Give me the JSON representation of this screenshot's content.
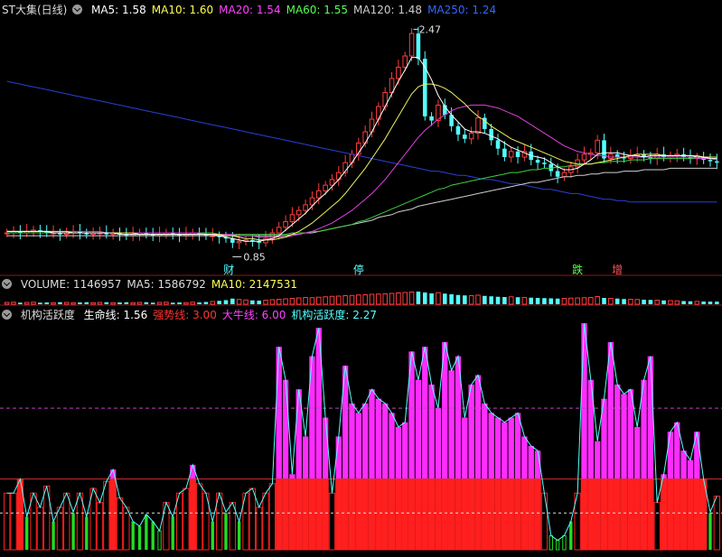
{
  "main_header": {
    "title": "ST大集(日线)",
    "items": [
      {
        "label": "MA5: 1.58",
        "color": "#ffffff"
      },
      {
        "label": "MA10: 1.60",
        "color": "#ffff55"
      },
      {
        "label": "MA20: 1.54",
        "color": "#ff44ff"
      },
      {
        "label": "MA60: 1.55",
        "color": "#55ff55"
      },
      {
        "label": "MA120: 1.48",
        "color": "#cccccc"
      },
      {
        "label": "MA250: 1.24",
        "color": "#3366ff"
      }
    ]
  },
  "volume_header": {
    "items": [
      {
        "label": "VOLUME: 1146957",
        "color": "#dddddd"
      },
      {
        "label": "MA5: 1586792",
        "color": "#dddddd"
      },
      {
        "label": "MA10: 2147531",
        "color": "#ffff55"
      }
    ]
  },
  "indicator_header": {
    "title": "机构活跃度",
    "items": [
      {
        "label": "生命线: 1.56",
        "color": "#ffffff"
      },
      {
        "label": "强势线: 3.00",
        "color": "#ff3333"
      },
      {
        "label": "大牛线: 6.00",
        "color": "#ff44ff"
      },
      {
        "label": "机构活跃度: 2.27",
        "color": "#55ffff"
      }
    ]
  },
  "annotations": {
    "high_label": "2.47",
    "low_label": "0.85",
    "events": [
      {
        "text": "财",
        "color": "#55ffff"
      },
      {
        "text": "停",
        "color": "#55ffff"
      },
      {
        "text": "跌",
        "color": "#55ff55"
      },
      {
        "text": "增",
        "color": "#ff5555"
      }
    ]
  },
  "chart_data": [
    {
      "type": "candlestick",
      "name": "price",
      "ylim": [
        0.75,
        2.55
      ],
      "close": [
        1.02,
        1.03,
        1.02,
        1.03,
        1.04,
        1.03,
        1.02,
        1.02,
        1.01,
        1.02,
        1.03,
        1.02,
        1.01,
        1.02,
        1.02,
        1.01,
        1.02,
        1.01,
        1.0,
        1.01,
        1.02,
        1.01,
        1.0,
        1.01,
        1.02,
        1.01,
        1.0,
        1.01,
        1.02,
        1.01,
        1.0,
        1.0,
        0.99,
        0.98,
        0.95,
        0.96,
        0.97,
        0.96,
        0.95,
        0.98,
        1.02,
        1.06,
        1.1,
        1.15,
        1.18,
        1.22,
        1.27,
        1.32,
        1.36,
        1.4,
        1.45,
        1.52,
        1.58,
        1.66,
        1.74,
        1.83,
        1.92,
        2.02,
        2.12,
        2.2,
        2.28,
        2.44,
        2.26,
        1.85,
        1.82,
        1.93,
        1.86,
        1.78,
        1.72,
        1.69,
        1.73,
        1.84,
        1.76,
        1.68,
        1.62,
        1.56,
        1.6,
        1.56,
        1.6,
        1.54,
        1.52,
        1.51,
        1.46,
        1.42,
        1.45,
        1.49,
        1.54,
        1.58,
        1.59,
        1.68,
        1.55,
        1.58,
        1.56,
        1.55,
        1.57,
        1.58,
        1.56,
        1.55,
        1.58,
        1.56,
        1.57,
        1.58,
        1.56,
        1.55,
        1.56,
        1.54,
        1.53,
        1.52
      ],
      "ma5": [
        1.03,
        1.03,
        1.03,
        1.03,
        1.03,
        1.03,
        1.03,
        1.02,
        1.02,
        1.02,
        1.02,
        1.02,
        1.02,
        1.02,
        1.02,
        1.02,
        1.02,
        1.01,
        1.01,
        1.01,
        1.01,
        1.01,
        1.01,
        1.01,
        1.01,
        1.01,
        1.01,
        1.01,
        1.01,
        1.01,
        1.01,
        1.01,
        1.0,
        0.99,
        0.98,
        0.97,
        0.96,
        0.96,
        0.96,
        0.97,
        0.98,
        1.0,
        1.04,
        1.08,
        1.12,
        1.16,
        1.21,
        1.26,
        1.3,
        1.35,
        1.4,
        1.46,
        1.52,
        1.59,
        1.66,
        1.74,
        1.83,
        1.92,
        2.01,
        2.1,
        2.18,
        2.27,
        2.27,
        2.2,
        2.11,
        2.0,
        1.92,
        1.86,
        1.81,
        1.76,
        1.74,
        1.74,
        1.73,
        1.71,
        1.69,
        1.66,
        1.63,
        1.61,
        1.59,
        1.57,
        1.56,
        1.55,
        1.52,
        1.49,
        1.47,
        1.47,
        1.48,
        1.51,
        1.54,
        1.58,
        1.59,
        1.59,
        1.59,
        1.58,
        1.57,
        1.57,
        1.56,
        1.57,
        1.57,
        1.57,
        1.57,
        1.57,
        1.57,
        1.57,
        1.56,
        1.56,
        1.55,
        1.55
      ],
      "ma10": [
        1.03,
        1.03,
        1.03,
        1.03,
        1.03,
        1.03,
        1.03,
        1.03,
        1.03,
        1.03,
        1.02,
        1.02,
        1.02,
        1.02,
        1.02,
        1.02,
        1.02,
        1.02,
        1.02,
        1.02,
        1.01,
        1.01,
        1.01,
        1.01,
        1.01,
        1.01,
        1.01,
        1.01,
        1.01,
        1.01,
        1.01,
        1.01,
        1.01,
        1.0,
        1.0,
        0.99,
        0.98,
        0.98,
        0.97,
        0.97,
        0.97,
        0.98,
        0.99,
        1.01,
        1.03,
        1.06,
        1.09,
        1.13,
        1.17,
        1.21,
        1.25,
        1.3,
        1.36,
        1.42,
        1.48,
        1.55,
        1.62,
        1.69,
        1.77,
        1.85,
        1.93,
        2.01,
        2.06,
        2.08,
        2.08,
        2.07,
        2.05,
        2.02,
        1.98,
        1.94,
        1.89,
        1.85,
        1.82,
        1.78,
        1.75,
        1.72,
        1.69,
        1.67,
        1.65,
        1.63,
        1.61,
        1.59,
        1.57,
        1.55,
        1.53,
        1.52,
        1.51,
        1.51,
        1.51,
        1.52,
        1.53,
        1.54,
        1.55,
        1.56,
        1.57,
        1.58,
        1.58,
        1.58,
        1.58,
        1.57,
        1.57,
        1.57,
        1.57,
        1.57,
        1.57,
        1.56,
        1.56,
        1.56
      ],
      "ma20": [
        1.03,
        1.03,
        1.03,
        1.03,
        1.03,
        1.03,
        1.03,
        1.03,
        1.03,
        1.03,
        1.03,
        1.03,
        1.03,
        1.03,
        1.03,
        1.02,
        1.02,
        1.02,
        1.02,
        1.02,
        1.02,
        1.02,
        1.02,
        1.02,
        1.02,
        1.02,
        1.02,
        1.02,
        1.02,
        1.02,
        1.01,
        1.01,
        1.01,
        1.01,
        1.01,
        1.0,
        1.0,
        1.0,
        0.99,
        0.99,
        0.99,
        0.99,
        0.99,
        1.0,
        1.01,
        1.02,
        1.03,
        1.05,
        1.07,
        1.09,
        1.12,
        1.15,
        1.18,
        1.22,
        1.26,
        1.3,
        1.35,
        1.4,
        1.46,
        1.52,
        1.58,
        1.64,
        1.7,
        1.75,
        1.79,
        1.83,
        1.86,
        1.89,
        1.91,
        1.92,
        1.93,
        1.93,
        1.93,
        1.92,
        1.91,
        1.89,
        1.87,
        1.85,
        1.82,
        1.79,
        1.76,
        1.73,
        1.7,
        1.67,
        1.64,
        1.62,
        1.6,
        1.59,
        1.58,
        1.57,
        1.57,
        1.56,
        1.56,
        1.56,
        1.56,
        1.56,
        1.56,
        1.56,
        1.56,
        1.56,
        1.56,
        1.56,
        1.56,
        1.56,
        1.55,
        1.55,
        1.55,
        1.54
      ],
      "ma60": [
        1.02,
        1.02,
        1.02,
        1.02,
        1.02,
        1.02,
        1.02,
        1.02,
        1.02,
        1.02,
        1.02,
        1.02,
        1.02,
        1.02,
        1.02,
        1.02,
        1.02,
        1.02,
        1.02,
        1.02,
        1.02,
        1.02,
        1.02,
        1.02,
        1.02,
        1.02,
        1.02,
        1.02,
        1.02,
        1.02,
        1.02,
        1.02,
        1.01,
        1.01,
        1.01,
        1.01,
        1.01,
        1.01,
        1.01,
        1.01,
        1.01,
        1.01,
        1.01,
        1.02,
        1.02,
        1.02,
        1.03,
        1.03,
        1.04,
        1.05,
        1.06,
        1.07,
        1.08,
        1.1,
        1.11,
        1.13,
        1.15,
        1.17,
        1.19,
        1.21,
        1.23,
        1.25,
        1.27,
        1.29,
        1.31,
        1.33,
        1.34,
        1.36,
        1.37,
        1.38,
        1.39,
        1.4,
        1.41,
        1.42,
        1.43,
        1.44,
        1.45,
        1.45,
        1.46,
        1.47,
        1.47,
        1.48,
        1.48,
        1.49,
        1.49,
        1.5,
        1.5,
        1.51,
        1.51,
        1.52,
        1.52,
        1.53,
        1.53,
        1.53,
        1.54,
        1.54,
        1.54,
        1.55,
        1.55,
        1.55,
        1.55,
        1.55,
        1.55,
        1.55,
        1.55,
        1.55,
        1.55,
        1.55
      ],
      "ma120": [
        1.0,
        1.0,
        1.0,
        1.0,
        1.0,
        1.0,
        1.0,
        1.0,
        1.0,
        1.0,
        1.0,
        1.0,
        1.0,
        1.0,
        1.0,
        1.0,
        1.0,
        1.0,
        1.0,
        1.0,
        1.0,
        1.0,
        1.0,
        1.0,
        1.0,
        1.0,
        1.0,
        1.0,
        1.0,
        1.0,
        1.0,
        1.0,
        1.0,
        1.0,
        1.0,
        1.0,
        1.0,
        1.0,
        1.0,
        1.0,
        1.0,
        1.0,
        1.0,
        1.01,
        1.01,
        1.02,
        1.02,
        1.03,
        1.04,
        1.05,
        1.06,
        1.07,
        1.08,
        1.09,
        1.1,
        1.11,
        1.13,
        1.14,
        1.15,
        1.17,
        1.18,
        1.19,
        1.21,
        1.22,
        1.23,
        1.24,
        1.25,
        1.26,
        1.27,
        1.28,
        1.29,
        1.3,
        1.31,
        1.32,
        1.33,
        1.34,
        1.35,
        1.36,
        1.37,
        1.38,
        1.38,
        1.39,
        1.4,
        1.41,
        1.42,
        1.42,
        1.43,
        1.43,
        1.44,
        1.44,
        1.45,
        1.45,
        1.45,
        1.46,
        1.46,
        1.46,
        1.47,
        1.47,
        1.47,
        1.47,
        1.48,
        1.48,
        1.48,
        1.48,
        1.48,
        1.48,
        1.48,
        1.48
      ],
      "ma250": [
        2.1,
        2.09,
        2.08,
        2.07,
        2.06,
        2.05,
        2.04,
        2.03,
        2.02,
        2.01,
        2.0,
        1.99,
        1.98,
        1.97,
        1.96,
        1.95,
        1.94,
        1.93,
        1.92,
        1.91,
        1.9,
        1.89,
        1.88,
        1.87,
        1.86,
        1.85,
        1.84,
        1.83,
        1.82,
        1.81,
        1.8,
        1.79,
        1.78,
        1.77,
        1.76,
        1.75,
        1.74,
        1.73,
        1.72,
        1.71,
        1.7,
        1.69,
        1.68,
        1.67,
        1.66,
        1.65,
        1.64,
        1.63,
        1.62,
        1.61,
        1.6,
        1.59,
        1.58,
        1.57,
        1.56,
        1.55,
        1.54,
        1.53,
        1.52,
        1.51,
        1.5,
        1.49,
        1.48,
        1.47,
        1.46,
        1.46,
        1.45,
        1.44,
        1.43,
        1.43,
        1.42,
        1.41,
        1.4,
        1.4,
        1.39,
        1.38,
        1.37,
        1.37,
        1.36,
        1.35,
        1.34,
        1.33,
        1.33,
        1.32,
        1.31,
        1.3,
        1.3,
        1.29,
        1.28,
        1.27,
        1.26,
        1.26,
        1.25,
        1.25,
        1.24,
        1.24,
        1.24,
        1.24,
        1.24,
        1.24,
        1.24,
        1.24,
        1.24,
        1.24,
        1.24,
        1.24,
        1.24,
        1.24
      ]
    },
    {
      "type": "bar",
      "name": "volume",
      "ylim": [
        0,
        6000000
      ],
      "values": [
        800000,
        900000,
        700000,
        800000,
        900000,
        700000,
        800000,
        700000,
        900000,
        800000,
        700000,
        800000,
        900000,
        700000,
        800000,
        900000,
        700000,
        800000,
        900000,
        700000,
        800000,
        900000,
        700000,
        800000,
        900000,
        700000,
        800000,
        700000,
        900000,
        800000,
        1000000,
        1200000,
        1500000,
        1800000,
        2500000,
        2100000,
        1900000,
        1700000,
        1600000,
        1800000,
        2000000,
        2200000,
        2400000,
        2600000,
        2800000,
        3000000,
        2900000,
        3100000,
        3300000,
        3500000,
        3600000,
        3800000,
        3900000,
        4100000,
        4200000,
        4400000,
        4500000,
        4600000,
        4800000,
        5000000,
        5200000,
        5400000,
        5600000,
        5200000,
        4800000,
        5100000,
        4700000,
        4400000,
        4100000,
        3900000,
        3800000,
        4000000,
        3700000,
        3500000,
        3300000,
        3200000,
        3300000,
        3100000,
        3000000,
        2900000,
        2800000,
        2700000,
        2600000,
        2500000,
        2600000,
        2700000,
        2800000,
        2900000,
        3000000,
        3400000,
        2800000,
        2600000,
        2500000,
        2300000,
        2200000,
        2100000,
        2000000,
        1900000,
        1800000,
        1700000,
        1600000,
        1500000,
        1400000,
        1300000,
        1250000,
        1200000,
        1150000,
        1146957
      ]
    },
    {
      "type": "bar",
      "name": "机构活跃度",
      "ylim": [
        0,
        9.6
      ],
      "levels": {
        "生命线": 1.56,
        "强势线": 3.0,
        "大牛线": 6.0
      },
      "values": [
        2.4,
        2.4,
        3.0,
        1.4,
        2.4,
        1.8,
        2.7,
        1.2,
        1.8,
        2.4,
        1.6,
        2.4,
        1.4,
        2.6,
        2.0,
        2.9,
        3.4,
        2.2,
        1.8,
        1.2,
        1.0,
        1.5,
        1.2,
        0.8,
        2.0,
        1.4,
        2.4,
        2.6,
        3.6,
        2.8,
        2.4,
        1.2,
        2.4,
        1.6,
        2.0,
        1.2,
        2.4,
        2.6,
        1.8,
        2.4,
        2.8,
        8.6,
        7.2,
        3.2,
        6.8,
        4.8,
        8.2,
        9.4,
        5.6,
        2.4,
        4.8,
        7.8,
        6.2,
        5.8,
        6.2,
        6.8,
        6.4,
        6.2,
        5.8,
        5.2,
        5.4,
        8.4,
        7.2,
        8.6,
        7.0,
        6.0,
        8.8,
        7.6,
        8.2,
        5.6,
        7.0,
        7.4,
        6.2,
        5.8,
        5.6,
        5.4,
        5.6,
        5.8,
        4.8,
        4.4,
        4.2,
        2.4,
        0.6,
        0.4,
        0.6,
        1.2,
        2.4,
        9.6,
        7.2,
        4.6,
        6.4,
        8.8,
        7.0,
        6.6,
        6.8,
        5.2,
        7.2,
        8.2,
        2.0,
        3.2,
        5.0,
        5.4,
        4.2,
        3.8,
        5.0,
        3.0,
        1.6,
        2.27
      ]
    }
  ]
}
